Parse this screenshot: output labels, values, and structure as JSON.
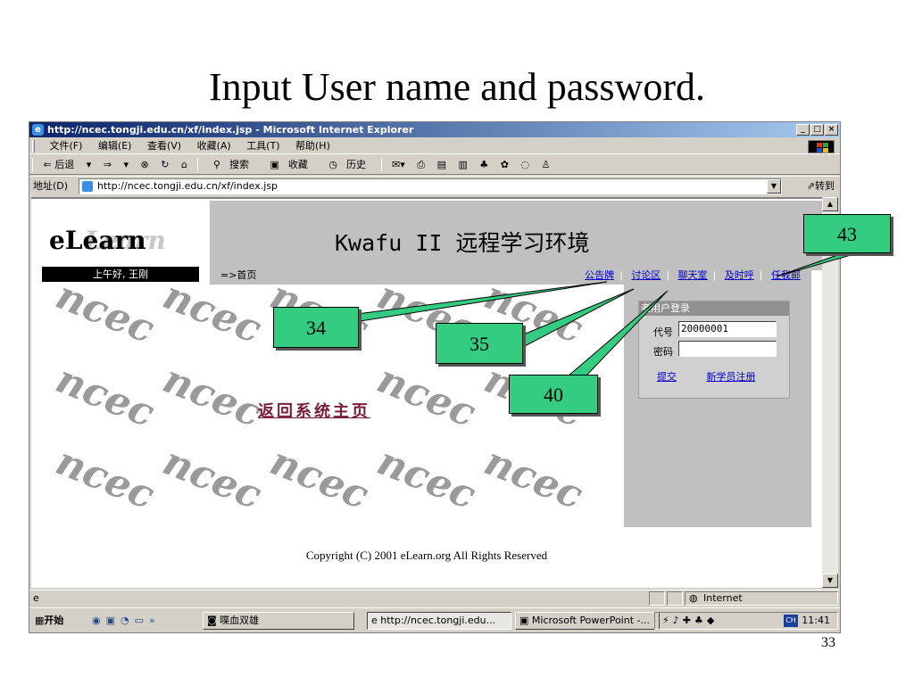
{
  "slide": {
    "title": "Input User name and password.",
    "number": "33"
  },
  "window": {
    "title": "http://ncec.tongji.edu.cn/xf/index.jsp - Microsoft Internet Explorer",
    "buttons": [
      "_",
      "□",
      "×"
    ]
  },
  "menu": [
    "文件(F)",
    "编辑(E)",
    "查看(V)",
    "收藏(A)",
    "工具(T)",
    "帮助(H)"
  ],
  "toolbar": {
    "back": "⇐ 后退",
    "forward": "⇒",
    "stop": "⊗",
    "refresh": "↻",
    "home": "⌂",
    "search": "搜索",
    "favorites": "收藏",
    "history": "历史"
  },
  "address": {
    "label": "地址(D)",
    "url": "http://ncec.tongji.edu.cn/xf/index.jsp",
    "go": "转到"
  },
  "page": {
    "logo": "eLearn",
    "site_title": "Kwafu II 远程学习环境",
    "greeting": "上午好, 王刚",
    "breadcrumb": "=>首页",
    "nav": [
      "公告牌",
      "讨论区",
      "聊天室",
      "及时呼",
      "任我邮"
    ],
    "watermark": "ncec",
    "return_link": "返回系统主页",
    "login": {
      "heading": "老用户登录",
      "id_label": "代号",
      "id_value": "20000001",
      "pwd_label": "密码",
      "pwd_value": "",
      "submit": "提交",
      "register": "新学员注册"
    },
    "copyright": "Copyright (C) 2001 eLearn.org All Rights Reserved"
  },
  "status": {
    "zone": "Internet"
  },
  "taskbar": {
    "start": "开始",
    "tasks": [
      "喋血双雄",
      "http://ncec.tongji.edu...",
      "Microsoft PowerPoint -..."
    ],
    "ime": "CH",
    "clock": "11:41"
  },
  "callouts": [
    "34",
    "35",
    "40",
    "43"
  ],
  "colors": {
    "callout": "#33cc80",
    "link": "#0000cc",
    "return_link": "#7a1d3a"
  }
}
